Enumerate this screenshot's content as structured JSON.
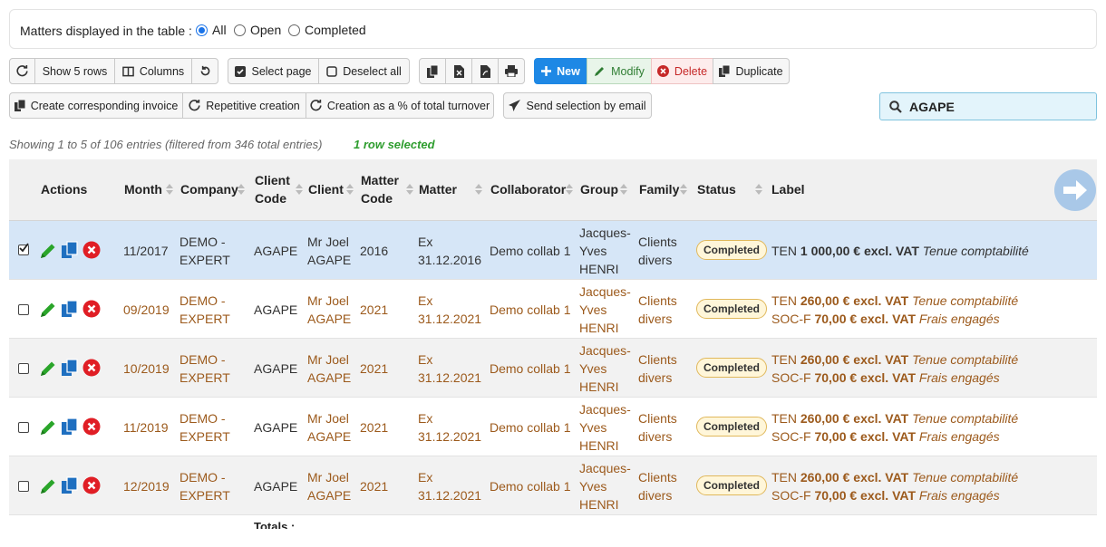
{
  "filter": {
    "label": "Matters displayed in the table :",
    "options": [
      {
        "label": "All",
        "checked": true
      },
      {
        "label": "Open",
        "checked": false
      },
      {
        "label": "Completed",
        "checked": false
      }
    ]
  },
  "toolbar": {
    "refresh_icon": "refresh-icon",
    "show_rows": "Show 5 rows",
    "columns": "Columns",
    "undo_icon": "undo-icon",
    "select_page": "Select page",
    "deselect_all": "Deselect all",
    "new": "New",
    "modify": "Modify",
    "delete": "Delete",
    "duplicate": "Duplicate",
    "create_invoice": "Create corresponding invoice",
    "repetitive": "Repetitive creation",
    "creation_pct": "Creation as a % of total turnover",
    "send_email": "Send selection by email"
  },
  "search": {
    "value": "AGAPE"
  },
  "info": {
    "showing": "Showing 1 to 5 of 106 entries (filtered from 346 total entries)",
    "selected": "1 row selected"
  },
  "table": {
    "headers": {
      "actions": "Actions",
      "month": "Month",
      "company": "Company",
      "client_code_1": "Client",
      "client_code_2": "Code",
      "client": "Client",
      "matter_code_1": "Matter",
      "matter_code_2": "Code",
      "matter": "Matter",
      "collaborator": "Collaborator",
      "group": "Group",
      "family": "Family",
      "status": "Status",
      "label": "Label"
    },
    "rows": [
      {
        "checked": true,
        "month": "11/2017",
        "company_1": "DEMO -",
        "company_2": "EXPERT",
        "client_code": "AGAPE",
        "client_1": "Mr Joel",
        "client_2": "AGAPE",
        "matter_code": "2016",
        "matter_1": "Ex",
        "matter_2": "31.12.2016",
        "collaborator": "Demo collab 1",
        "group_1": "Jacques-",
        "group_2": "Yves",
        "group_3": "HENRI",
        "family_1": "Clients",
        "family_2": "divers",
        "status": "Completed",
        "label_lines": [
          {
            "code": "TEN",
            "amount": "1 000,00 € excl. VAT",
            "desc": "Tenue comptabilité"
          }
        ]
      },
      {
        "checked": false,
        "month": "09/2019",
        "company_1": "DEMO -",
        "company_2": "EXPERT",
        "client_code": "AGAPE",
        "client_1": "Mr Joel",
        "client_2": "AGAPE",
        "matter_code": "2021",
        "matter_1": "Ex",
        "matter_2": "31.12.2021",
        "collaborator": "Demo collab 1",
        "group_1": "Jacques-",
        "group_2": "Yves",
        "group_3": "HENRI",
        "family_1": "Clients",
        "family_2": "divers",
        "status": "Completed",
        "label_lines": [
          {
            "code": "TEN",
            "amount": "260,00 € excl. VAT",
            "desc": "Tenue comptabilité"
          },
          {
            "code": "SOC-F",
            "amount": "70,00 € excl. VAT",
            "desc": "Frais engagés"
          }
        ]
      },
      {
        "checked": false,
        "month": "10/2019",
        "company_1": "DEMO -",
        "company_2": "EXPERT",
        "client_code": "AGAPE",
        "client_1": "Mr Joel",
        "client_2": "AGAPE",
        "matter_code": "2021",
        "matter_1": "Ex",
        "matter_2": "31.12.2021",
        "collaborator": "Demo collab 1",
        "group_1": "Jacques-",
        "group_2": "Yves",
        "group_3": "HENRI",
        "family_1": "Clients",
        "family_2": "divers",
        "status": "Completed",
        "label_lines": [
          {
            "code": "TEN",
            "amount": "260,00 € excl. VAT",
            "desc": "Tenue comptabilité"
          },
          {
            "code": "SOC-F",
            "amount": "70,00 € excl. VAT",
            "desc": "Frais engagés"
          }
        ]
      },
      {
        "checked": false,
        "month": "11/2019",
        "company_1": "DEMO -",
        "company_2": "EXPERT",
        "client_code": "AGAPE",
        "client_1": "Mr Joel",
        "client_2": "AGAPE",
        "matter_code": "2021",
        "matter_1": "Ex",
        "matter_2": "31.12.2021",
        "collaborator": "Demo collab 1",
        "group_1": "Jacques-",
        "group_2": "Yves",
        "group_3": "HENRI",
        "family_1": "Clients",
        "family_2": "divers",
        "status": "Completed",
        "label_lines": [
          {
            "code": "TEN",
            "amount": "260,00 € excl. VAT",
            "desc": "Tenue comptabilité"
          },
          {
            "code": "SOC-F",
            "amount": "70,00 € excl. VAT",
            "desc": "Frais engagés"
          }
        ]
      },
      {
        "checked": false,
        "month": "12/2019",
        "company_1": "DEMO -",
        "company_2": "EXPERT",
        "client_code": "AGAPE",
        "client_1": "Mr Joel",
        "client_2": "AGAPE",
        "matter_code": "2021",
        "matter_1": "Ex",
        "matter_2": "31.12.2021",
        "collaborator": "Demo collab 1",
        "group_1": "Jacques-",
        "group_2": "Yves",
        "group_3": "HENRI",
        "family_1": "Clients",
        "family_2": "divers",
        "status": "Completed",
        "label_lines": [
          {
            "code": "TEN",
            "amount": "260,00 € excl. VAT",
            "desc": "Tenue comptabilité"
          },
          {
            "code": "SOC-F",
            "amount": "70,00 € excl. VAT",
            "desc": "Frais engagés"
          }
        ]
      }
    ],
    "totals": "Totals :"
  }
}
